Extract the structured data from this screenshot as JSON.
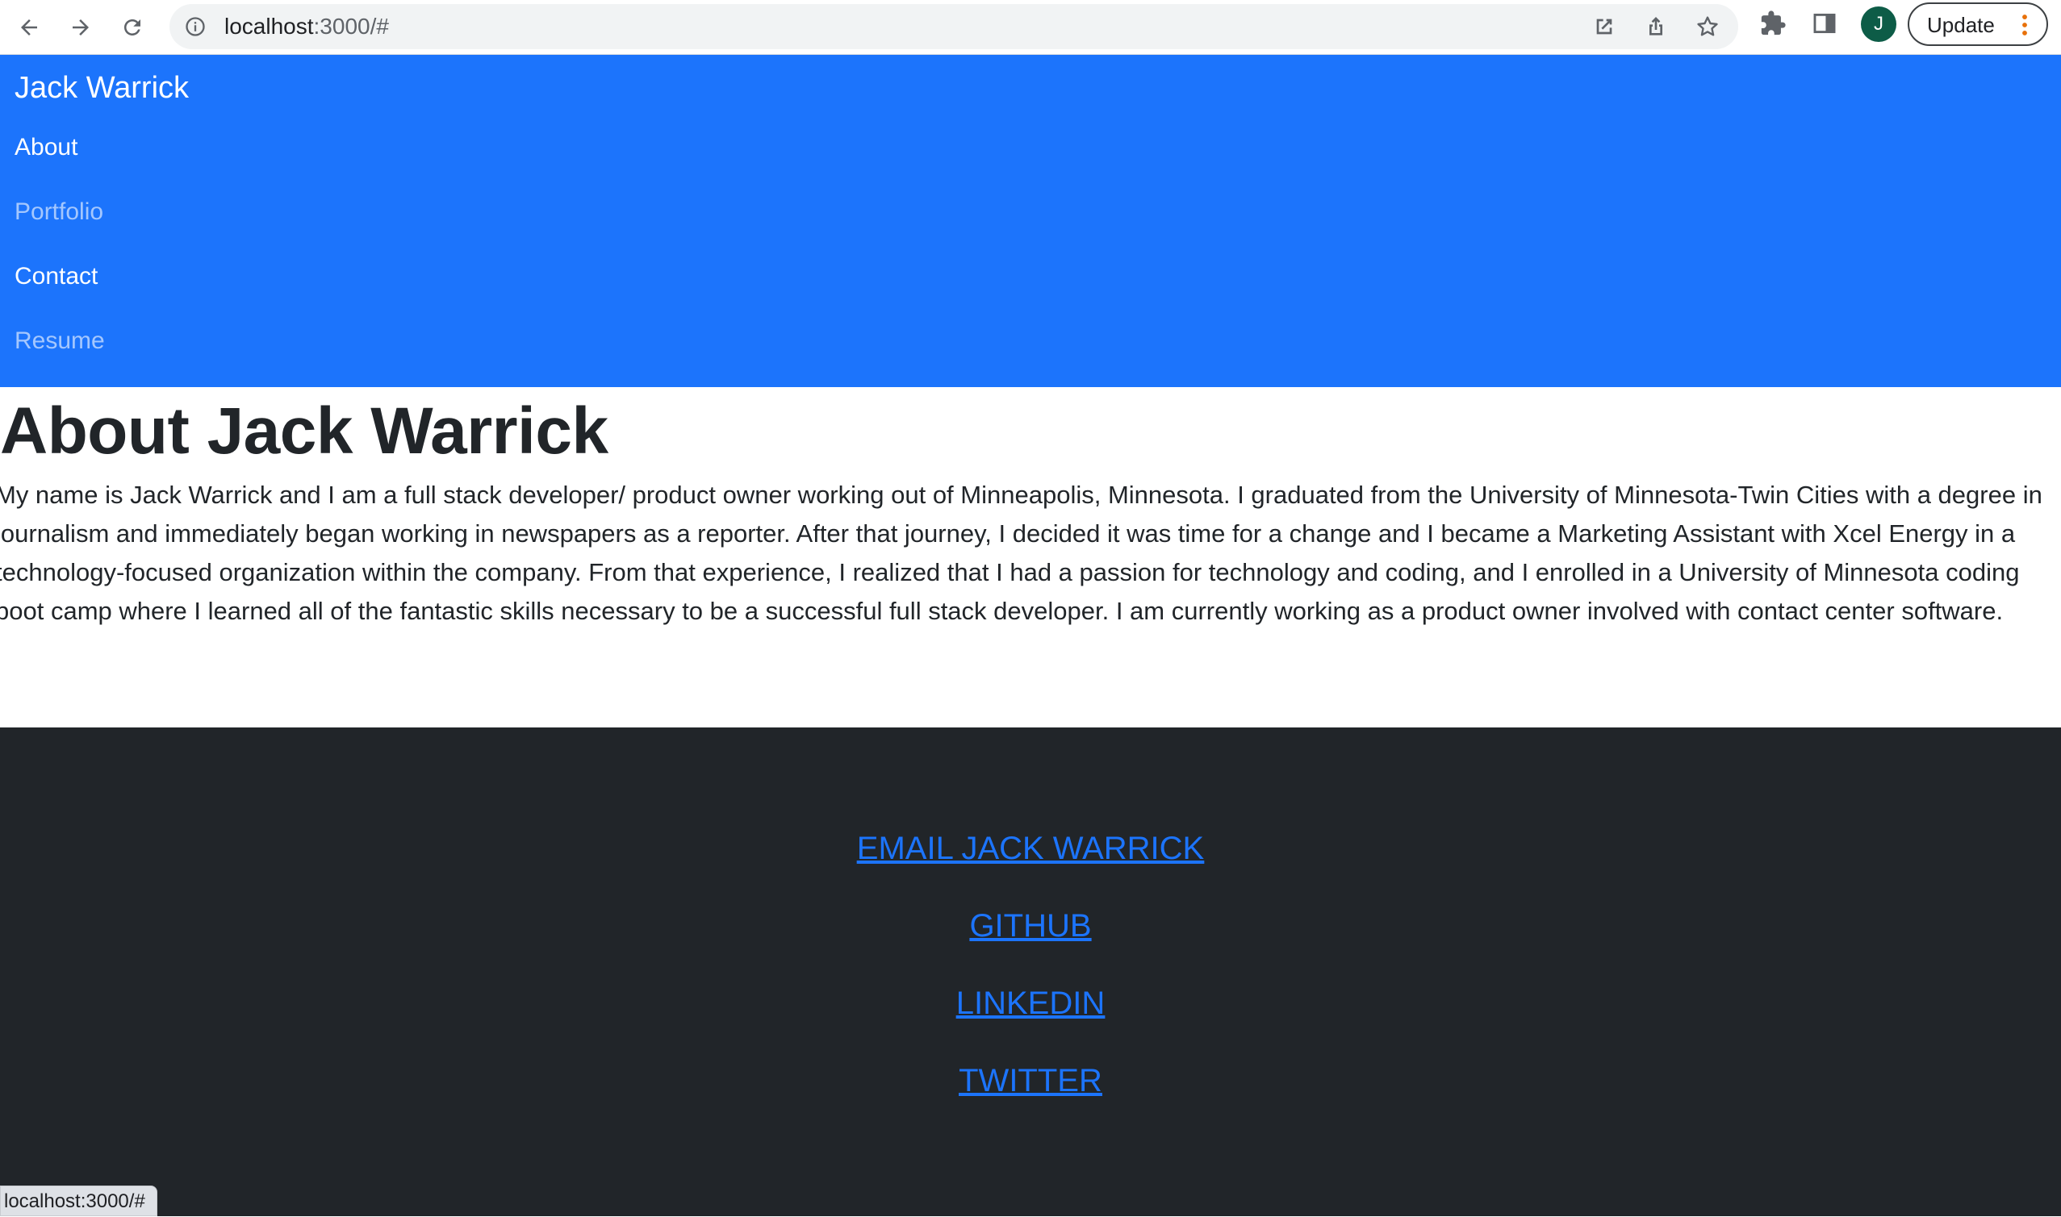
{
  "browser": {
    "url_host": "localhost",
    "url_path": ":3000/#",
    "update_label": "Update",
    "avatar_initial": "J",
    "status_url": "localhost:3000/#",
    "profile_color": "#0d5c47"
  },
  "navbar": {
    "brand": "Jack Warrick",
    "background": "#1c74fc",
    "links": [
      {
        "label": "About",
        "state": "active"
      },
      {
        "label": "Portfolio",
        "state": "muted"
      },
      {
        "label": "Contact",
        "state": "active"
      },
      {
        "label": "Resume",
        "state": "muted"
      }
    ]
  },
  "about": {
    "title": "About Jack Warrick",
    "body": "My name is Jack Warrick and I am a full stack developer/ product owner working out of Minneapolis, Minnesota. I graduated from the University of Minnesota-Twin Cities with a degree in journalism and immediately began working in newspapers as a reporter. After that journey, I decided it was time for a change and I became a Marketing Assistant with Xcel Energy in a technology-focused organization within the company. From that experience, I realized that I had a passion for technology and coding, and I enrolled in a University of Minnesota coding boot camp where I learned all of the fantastic skills necessary to be a successful full stack developer. I am currently working as a product owner involved with contact center software."
  },
  "footer": {
    "background": "#212529",
    "link_color": "#1c74fc",
    "links": [
      {
        "label": "EMAIL JACK WARRICK"
      },
      {
        "label": "GITHUB"
      },
      {
        "label": "LINKEDIN"
      },
      {
        "label": "TWITTER"
      }
    ]
  },
  "icons": {
    "back": "arrow-left-icon",
    "forward": "arrow-right-icon",
    "reload": "reload-icon",
    "site_info": "info-icon",
    "open_in_app": "external-link-icon",
    "share": "share-icon",
    "bookmark": "star-icon",
    "extensions": "puzzle-icon",
    "side_panel": "side-panel-icon",
    "menu": "kebab-menu-icon"
  }
}
